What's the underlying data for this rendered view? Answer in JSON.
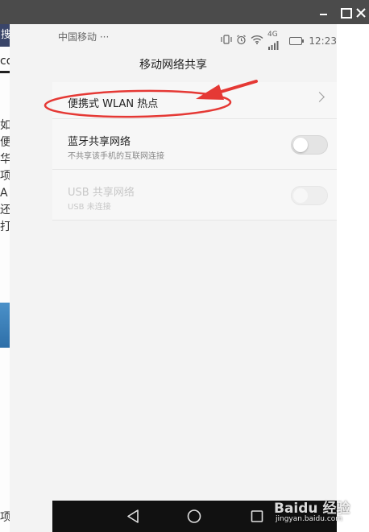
{
  "host": {
    "left_tab_text": "搜",
    "left_top_text": "co",
    "left_column_chars": "如 便 华 项 A 还 打",
    "left_bottom_text": "项"
  },
  "status_bar": {
    "carrier": "中国移动 ···",
    "network_type": "4G",
    "time": "12:23",
    "icons": [
      "vibrate-icon",
      "alarm-icon",
      "wifi-icon",
      "signal-icon",
      "battery-icon"
    ]
  },
  "page": {
    "title": "移动网络共享"
  },
  "settings": [
    {
      "title": "便携式 WLAN 热点",
      "control": "chevron"
    },
    {
      "title": "蓝牙共享网络",
      "subtitle": "不共享该手机的互联网连接",
      "control": "toggle",
      "state": "off"
    },
    {
      "title": "USB 共享网络",
      "subtitle": "USB 未连接",
      "control": "toggle",
      "state": "off",
      "enabled": false
    }
  ],
  "annotation": {
    "color": "#e53935",
    "shape": "ellipse-with-arrow"
  },
  "nav_bar": {
    "buttons": [
      "back-icon",
      "home-icon",
      "recent-apps-icon"
    ]
  },
  "watermark": {
    "text": "Baidu 经验",
    "url": "jingyan.baidu.com"
  }
}
